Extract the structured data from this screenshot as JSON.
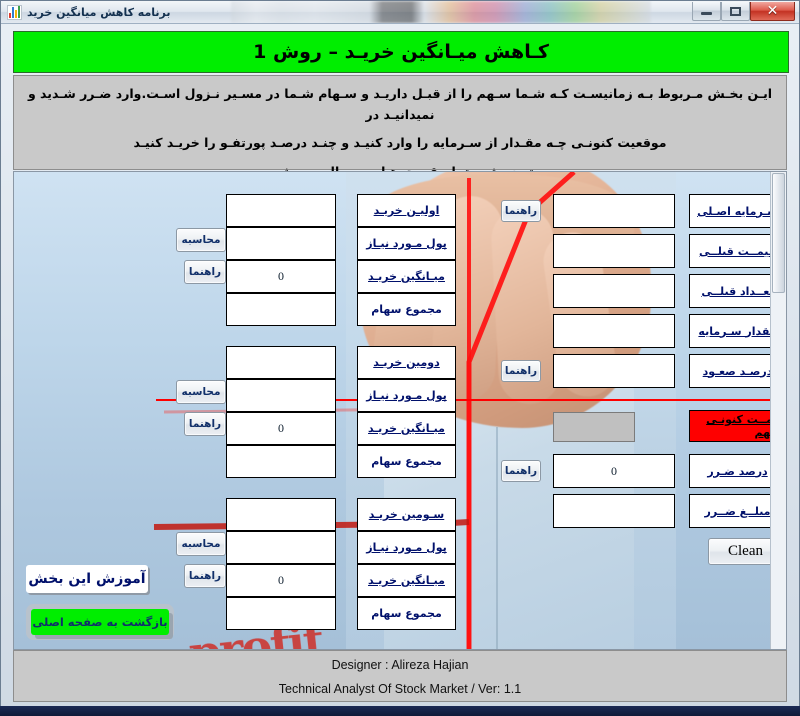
{
  "window": {
    "title": "برنامه کاهش میانگین خرید",
    "icon": "chart-icon",
    "minimize": "–",
    "maximize": "□",
    "close": "✕"
  },
  "header": {
    "title": "کـاهش میـانگین خریـد – روش 1",
    "background_color": "#00ee00"
  },
  "description": {
    "line1": "ایـن بخـش مـربوط بـه زمانیسـت کـه شـما سـهم را از قبـل داریـد و سـهام شـما در مسـیر نـزول اسـت.وارد ضـرر شـدید و نمیدانیـد در",
    "line2": "موقعیت کنونـی چـه مقـدار از سـرمایه را وارد کنیـد و چنـد درصـد پورتفـو را خریـد کنیـد",
    "note": "توجه شود تمام قیمت هـا بـه ریـال درج شود"
  },
  "right_panel": {
    "fields": [
      {
        "label": "سـرمایه اصـلی",
        "value": "",
        "help": "راهنما",
        "has_help": true
      },
      {
        "label": "قیمــت قبلــی",
        "value": "",
        "help": "",
        "has_help": false
      },
      {
        "label": "تعــداد قبلــی",
        "value": "",
        "help": "",
        "has_help": false
      },
      {
        "label": "مقدار سـرمایه",
        "value": "",
        "help": "",
        "has_help": false
      },
      {
        "label": "درصـد صعـود",
        "value": "",
        "help": "راهنما",
        "has_help": true
      }
    ],
    "current_price": {
      "label": "قیمــت کنونـی سـهم",
      "value": "",
      "disabled": true,
      "label_color": "#fe0000"
    },
    "loss_percent": {
      "label": "درصد ضـرر",
      "value": "0",
      "help": "راهنما",
      "has_help": true
    },
    "loss_amount": {
      "label": "مبلــغ ضــرر",
      "value": "",
      "has_help": false
    },
    "clean_button": "Clean"
  },
  "purchase_groups": [
    {
      "title": "اولیـن خریـد",
      "rows": [
        {
          "label": "اولیـن خریـد",
          "value": ""
        },
        {
          "label": "پول مـورد نیـاز",
          "value": ""
        },
        {
          "label": "میـانگین خریـد",
          "value": "0"
        },
        {
          "label": "مجموع سهام",
          "value": ""
        }
      ],
      "calc_button": "محاسبه",
      "help_button": "راهنما"
    },
    {
      "title": "دومین خریـد",
      "rows": [
        {
          "label": "دومین خریـد",
          "value": ""
        },
        {
          "label": "پول مـورد نیـاز",
          "value": ""
        },
        {
          "label": "میـانگین خریـد",
          "value": "0"
        },
        {
          "label": "مجموع سهام",
          "value": ""
        }
      ],
      "calc_button": "محاسبه",
      "help_button": "راهنما"
    },
    {
      "title": "سـومین خریـد",
      "rows": [
        {
          "label": "سـومین خریـد",
          "value": ""
        },
        {
          "label": "پول مـورد نیـاز",
          "value": ""
        },
        {
          "label": "میـانگین خریـد",
          "value": "0"
        },
        {
          "label": "مجموع سهام",
          "value": ""
        }
      ],
      "calc_button": "محاسبه",
      "help_button": "راهنما"
    }
  ],
  "bottom_buttons": {
    "tutorial": "آموزش این بخش",
    "back_home": "بازگشت به صفحه اصلی"
  },
  "background": {
    "watermark_text": "profit",
    "accent_line_color": "#ff0000"
  },
  "footer": {
    "designer": "Designer : Alireza Hajian",
    "role_version": "Technical Analyst Of Stock Market / Ver: 1.1"
  }
}
